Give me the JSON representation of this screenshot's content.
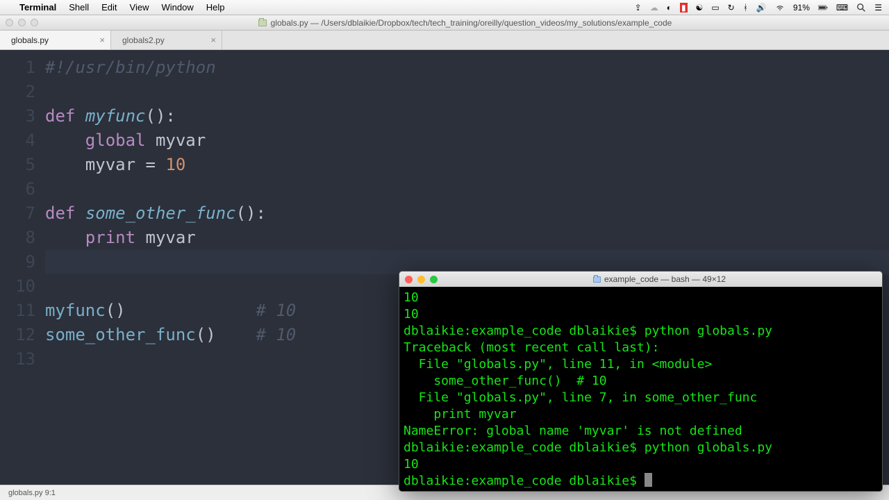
{
  "menubar": {
    "appname": "Terminal",
    "items": [
      "Shell",
      "Edit",
      "View",
      "Window",
      "Help"
    ],
    "battery": "91%"
  },
  "window": {
    "title": "globals.py — /Users/dblaikie/Dropbox/tech/tech_training/oreilly/question_videos/my_solutions/example_code"
  },
  "tabs": [
    {
      "label": "globals.py",
      "active": true
    },
    {
      "label": "globals2.py",
      "active": false
    }
  ],
  "code": {
    "line1_comment": "#!/usr/bin/python",
    "l3_def": "def",
    "l3_fn": "myfunc",
    "l3_paren": "():",
    "l4_kw": "global",
    "l4_var": " myvar",
    "l5_var": "myvar = ",
    "l5_num": "10",
    "l7_def": "def",
    "l7_fn": "some_other_func",
    "l7_paren": "():",
    "l8_kw": "print",
    "l8_var": " myvar",
    "l11_call": "myfunc",
    "l11_paren": "()",
    "l11_cm": "# 10",
    "l12_call": "some_other_func",
    "l12_paren": "()",
    "l12_cm": "# 10"
  },
  "gutter": {
    "n1": "1",
    "n2": "2",
    "n3": "3",
    "n4": "4",
    "n5": "5",
    "n6": "6",
    "n7": "7",
    "n8": "8",
    "n9": "9",
    "n10": "10",
    "n11": "11",
    "n12": "12",
    "n13": "13"
  },
  "statusbar": "globals.py   9:1",
  "terminal": {
    "title": "example_code — bash — 49×12",
    "lines": [
      "10",
      "10",
      "dblaikie:example_code dblaikie$ python globals.py",
      "Traceback (most recent call last):",
      "  File \"globals.py\", line 11, in <module>",
      "    some_other_func()  # 10",
      "  File \"globals.py\", line 7, in some_other_func",
      "    print myvar",
      "NameError: global name 'myvar' is not defined",
      "dblaikie:example_code dblaikie$ python globals.py",
      "10",
      "dblaikie:example_code dblaikie$ "
    ]
  }
}
